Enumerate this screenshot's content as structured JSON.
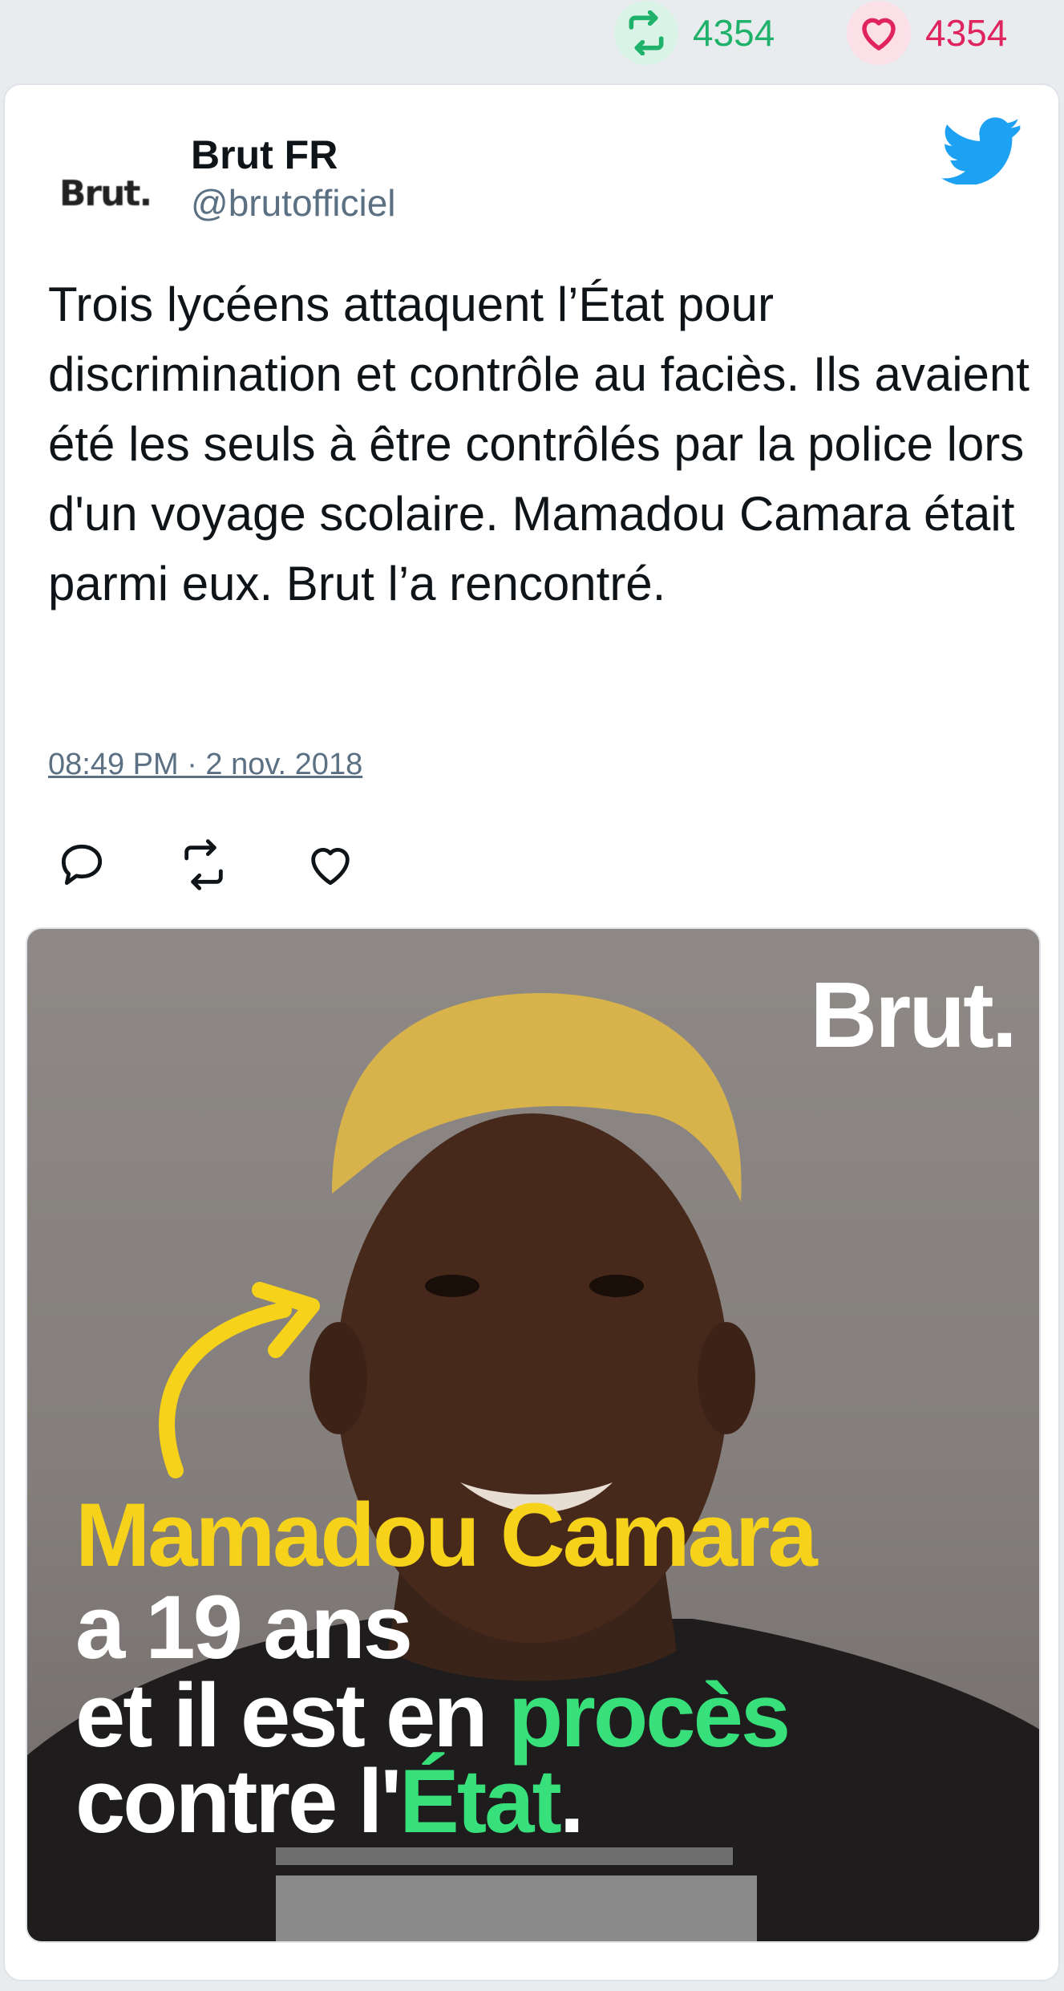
{
  "stats": {
    "retweets": "4354",
    "likes": "4354",
    "retweet_color": "#20b26b",
    "like_color": "#e0245e"
  },
  "tweet": {
    "avatar_text": "Brut.",
    "name": "Brut FR",
    "handle": "@brutofficiel",
    "text": "Trois lycéens attaquent l’État pour discrimination et contrôle au faciès. Ils avaient été les seuls à être contrôlés par la police lors d'un voyage scolaire. Mamadou Camara était parmi eux. Brut l’a rencontré.",
    "timestamp": "08:49 PM · 2 nov. 2018",
    "icons": [
      "retweet-icon",
      "heart-icon",
      "twitter-bird-icon",
      "reply-icon"
    ],
    "brand_color": "#1da1f2"
  },
  "media": {
    "logo": "Brut.",
    "line1": "Mamadou Camara",
    "line2": "a 19 ans",
    "line3a": "et il est en ",
    "line3b": "procès",
    "line4a": "contre l'",
    "line4b": "État",
    "line4c": "."
  }
}
